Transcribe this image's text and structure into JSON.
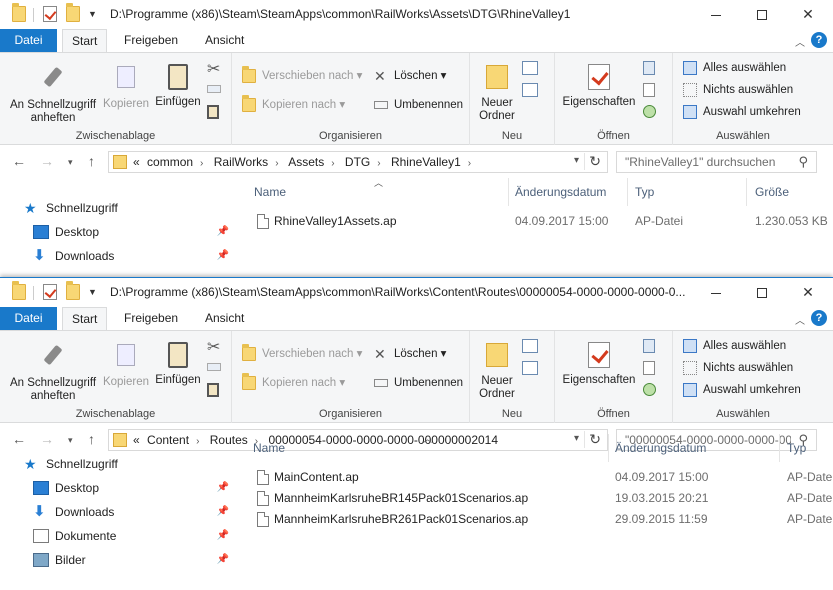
{
  "windows": [
    {
      "title": "D:\\Programme (x86)\\Steam\\SteamApps\\common\\RailWorks\\Assets\\DTG\\RhineValley1",
      "tabs": {
        "file": "Datei",
        "start": "Start",
        "share": "Freigeben",
        "view": "Ansicht"
      },
      "ribbon": {
        "pin_quick": "An Schnellzugriff anheften",
        "copy": "Kopieren",
        "paste": "Einfügen",
        "clipboard_group": "Zwischenablage",
        "move_to": "Verschieben nach",
        "copy_to": "Kopieren nach",
        "delete": "Löschen",
        "rename": "Umbenennen",
        "organize_group": "Organisieren",
        "new_folder": "Neuer Ordner",
        "new_group": "Neu",
        "properties": "Eigenschaften",
        "open_group": "Öffnen",
        "select_all": "Alles auswählen",
        "select_none": "Nichts auswählen",
        "invert_selection": "Auswahl umkehren",
        "select_group": "Auswählen"
      },
      "breadcrumb": [
        "common",
        "RailWorks",
        "Assets",
        "DTG",
        "RhineValley1"
      ],
      "breadcrumb_prefix": "«",
      "search_placeholder": "\"RhineValley1\" durchsuchen",
      "nav": [
        {
          "label": "Schnellzugriff",
          "icon": "star-icon"
        },
        {
          "label": "Desktop",
          "icon": "desktop-icon",
          "pinned": true
        },
        {
          "label": "Downloads",
          "icon": "download-icon",
          "pinned": true
        }
      ],
      "columns": {
        "name": "Name",
        "date": "Änderungsdatum",
        "type": "Typ",
        "size": "Größe"
      },
      "files": [
        {
          "name": "RhineValley1Assets.ap",
          "date": "04.09.2017 15:00",
          "type": "AP-Datei",
          "size": "1.230.053 KB"
        }
      ]
    },
    {
      "title": "D:\\Programme (x86)\\Steam\\SteamApps\\common\\RailWorks\\Content\\Routes\\00000054-0000-0000-0000-0...",
      "tabs": {
        "file": "Datei",
        "start": "Start",
        "share": "Freigeben",
        "view": "Ansicht"
      },
      "ribbon": {
        "pin_quick": "An Schnellzugriff anheften",
        "copy": "Kopieren",
        "paste": "Einfügen",
        "clipboard_group": "Zwischenablage",
        "move_to": "Verschieben nach",
        "copy_to": "Kopieren nach",
        "delete": "Löschen",
        "rename": "Umbenennen",
        "organize_group": "Organisieren",
        "new_folder": "Neuer Ordner",
        "new_group": "Neu",
        "properties": "Eigenschaften",
        "open_group": "Öffnen",
        "select_all": "Alles auswählen",
        "select_none": "Nichts auswählen",
        "invert_selection": "Auswahl umkehren",
        "select_group": "Auswählen"
      },
      "breadcrumb": [
        "Content",
        "Routes",
        "00000054-0000-0000-0000-000000002014"
      ],
      "breadcrumb_prefix": "«",
      "search_placeholder": "\"00000054-0000-0000-0000-00...",
      "nav": [
        {
          "label": "Schnellzugriff",
          "icon": "star-icon"
        },
        {
          "label": "Desktop",
          "icon": "desktop-icon",
          "pinned": true
        },
        {
          "label": "Downloads",
          "icon": "download-icon",
          "pinned": true
        },
        {
          "label": "Dokumente",
          "icon": "documents-icon",
          "pinned": true
        },
        {
          "label": "Bilder",
          "icon": "pictures-icon",
          "pinned": true
        }
      ],
      "columns": {
        "name": "Name",
        "date": "Änderungsdatum",
        "type": "Typ"
      },
      "files": [
        {
          "name": "MainContent.ap",
          "date": "04.09.2017 15:00",
          "type": "AP-Date"
        },
        {
          "name": "MannheimKarlsruheBR145Pack01Scenarios.ap",
          "date": "19.03.2015 20:21",
          "type": "AP-Date"
        },
        {
          "name": "MannheimKarlsruheBR261Pack01Scenarios.ap",
          "date": "29.09.2015 11:59",
          "type": "AP-Date"
        }
      ]
    }
  ],
  "window_buttons": {
    "close": "✕"
  },
  "colors": {
    "accent": "#1979ca",
    "ribbon_bg": "#f5f6f7",
    "folder": "#f8d775"
  }
}
